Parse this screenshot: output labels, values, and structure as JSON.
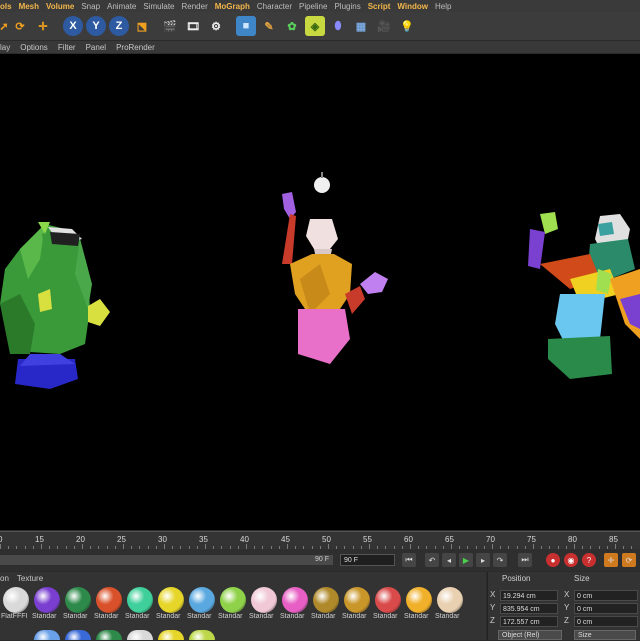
{
  "menu": [
    "ols",
    "Mesh",
    "Volume",
    "Snap",
    "Animate",
    "Simulate",
    "Render",
    "MoGraph",
    "Character",
    "Pipeline",
    "Plugins",
    "Script",
    "Window",
    "Help"
  ],
  "highlighted_menu": [
    "ols",
    "Mesh",
    "Volume",
    "MoGraph",
    "Script",
    "Window"
  ],
  "toolbar_icons": [
    "arrow-icon",
    "rotate-icon",
    "move-icon",
    "x-axis-icon",
    "y-axis-icon",
    "z-axis-icon",
    "coordinate-system-icon",
    "render-region-icon",
    "render-view-icon",
    "render-settings-icon",
    "cube-icon",
    "pen-icon",
    "generator-icon",
    "deformer-icon",
    "capsule-icon",
    "floor-icon",
    "camera-icon",
    "light-icon"
  ],
  "axis_labels": {
    "x": "X",
    "y": "Y",
    "z": "Z"
  },
  "viewport_menu": [
    "lay",
    "Options",
    "Filter",
    "Panel",
    "ProRender"
  ],
  "timeline": {
    "ticks": [
      "0",
      "15",
      "20",
      "25",
      "30",
      "35",
      "40",
      "45",
      "50",
      "55",
      "60",
      "65",
      "70",
      "75",
      "80",
      "85"
    ],
    "end_frame": "90 F",
    "frame_field": "90 F"
  },
  "materials_tabs": [
    "on",
    "Texture"
  ],
  "materials": [
    {
      "label": "FlatFFFI",
      "color": "#d9d9d9"
    },
    {
      "label": "Standar",
      "color": "#7a3fd0"
    },
    {
      "label": "Standar",
      "color": "#2e8a4a"
    },
    {
      "label": "Standar",
      "color": "#d9512a"
    },
    {
      "label": "Standar",
      "color": "#3fcf9a"
    },
    {
      "label": "Standar",
      "color": "#e6d62a"
    },
    {
      "label": "Standar",
      "color": "#5aa8e0"
    },
    {
      "label": "Standar",
      "color": "#8fd24a"
    },
    {
      "label": "Standar",
      "color": "#f0c8d6"
    },
    {
      "label": "Standar",
      "color": "#e75fc4"
    },
    {
      "label": "Standar",
      "color": "#b08a2a"
    },
    {
      "label": "Standar",
      "color": "#c9962a"
    },
    {
      "label": "Standar",
      "color": "#d94a4a"
    },
    {
      "label": "Standar",
      "color": "#f0b02a"
    },
    {
      "label": "Standar",
      "color": "#e8d0b0"
    }
  ],
  "materials_row2": [
    "#6aa0e8",
    "#3a6ad8",
    "#2e8a4a",
    "#d9d9d9",
    "#e6d62a",
    "#bcd84a"
  ],
  "coords": {
    "position_header": "Position",
    "size_header": "Size",
    "rows": [
      {
        "axis": "X",
        "value": "19.294 cm",
        "axis2": "X",
        "value2": "0 cm"
      },
      {
        "axis": "Y",
        "value": "835.954 cm",
        "axis2": "Y",
        "value2": "0 cm"
      },
      {
        "axis": "Z",
        "value": "172.557 cm",
        "axis2": "Z",
        "value2": "0 cm"
      }
    ],
    "mode_select": "Object (Rel)",
    "size_select": "Size"
  }
}
